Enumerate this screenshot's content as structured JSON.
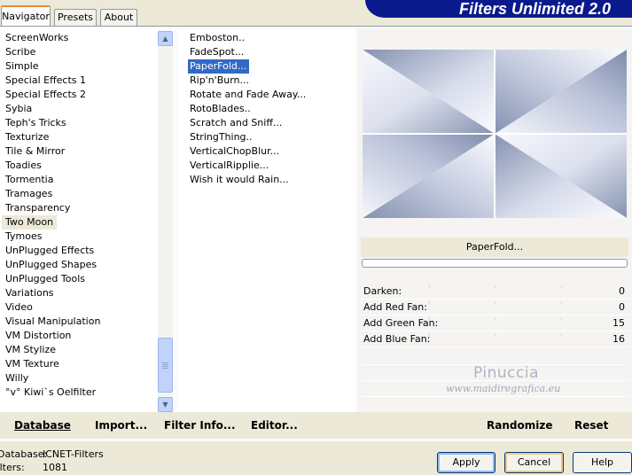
{
  "tabs": [
    {
      "label": "Navigator",
      "active": true
    },
    {
      "label": "Presets",
      "active": false
    },
    {
      "label": "About",
      "active": false
    }
  ],
  "app_title": "Filters Unlimited 2.0",
  "categories": [
    "ScreenWorks",
    "Scribe",
    "Simple",
    "Special Effects 1",
    "Special Effects 2",
    "Sybia",
    "Teph's Tricks",
    "Texturize",
    "Tile & Mirror",
    "Toadies",
    "Tormentia",
    "Tramages",
    "Transparency",
    "Two Moon",
    "Tymoes",
    "UnPlugged Effects",
    "UnPlugged Shapes",
    "UnPlugged Tools",
    "Variations",
    "Video",
    "Visual Manipulation",
    "VM Distortion",
    "VM Stylize",
    "VM Texture",
    "Willy",
    "°v° Kiwi`s Oelfilter"
  ],
  "selected_category": "Two Moon",
  "filters": [
    "Emboston..",
    "FadeSpot...",
    "PaperFold...",
    "Rip'n'Burn...",
    "Rotate and Fade Away...",
    "RotoBlades..",
    "Scratch and Sniff...",
    "StringThing..",
    "VerticalChopBlur...",
    "VerticalRipplie...",
    "Wish it would Rain..."
  ],
  "selected_filter": "PaperFold...",
  "current_filter_name": "PaperFold...",
  "progress": 0,
  "parameters": [
    {
      "label": "Darken:",
      "value": "0"
    },
    {
      "label": "Add Red Fan:",
      "value": "0"
    },
    {
      "label": "Add Green Fan:",
      "value": "15"
    },
    {
      "label": "Add Blue Fan:",
      "value": "16"
    }
  ],
  "watermark": {
    "name": "Pinuccia",
    "site": "www.maidiregrafica.eu"
  },
  "bottom_bar": {
    "database": "Database",
    "import": "Import...",
    "filter_info": "Filter Info...",
    "editor": "Editor...",
    "randomize": "Randomize",
    "reset": "Reset"
  },
  "status": {
    "database_label": "Database:",
    "database_value": "ICNET-Filters",
    "filters_label": "Filters:",
    "filters_value": "1081"
  },
  "buttons": {
    "apply": "Apply",
    "cancel": "Cancel",
    "help": "Help"
  },
  "colors": {
    "banner": "#0a1a8c",
    "selection": "#316ac5",
    "preview_light": "#f4f6fb",
    "preview_dark": "#8592b0"
  }
}
